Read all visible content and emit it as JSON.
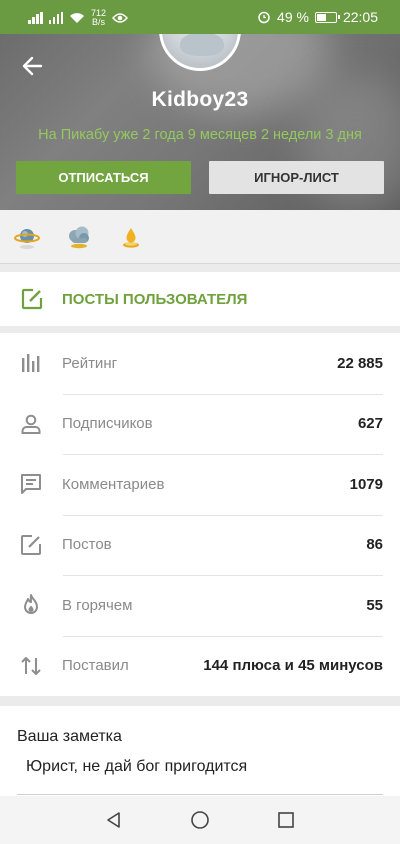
{
  "status_bar": {
    "net_speed_value": "712",
    "net_speed_unit": "B/s",
    "battery": "49 %",
    "time": "22:05"
  },
  "profile": {
    "username": "Kidboy23",
    "since": "На Пикабу уже 2 года 9 месяцев 2 недели 3 дня",
    "unsubscribe_label": "Отписаться",
    "ignore_label": "Игнор-лист"
  },
  "awards": [
    "planet-award-icon",
    "cloud-award-icon",
    "gold-drop-award-icon"
  ],
  "posts_link": {
    "label": "Посты пользователя"
  },
  "stats": [
    {
      "icon": "rating-bars-icon",
      "label": "Рейтинг",
      "value": "22 885"
    },
    {
      "icon": "person-icon",
      "label": "Подписчиков",
      "value": "627"
    },
    {
      "icon": "comment-icon",
      "label": "Комментариев",
      "value": "1079"
    },
    {
      "icon": "edit-icon",
      "label": "Постов",
      "value": "86"
    },
    {
      "icon": "flame-icon",
      "label": "В горячем",
      "value": "55"
    },
    {
      "icon": "up-down-arrows-icon",
      "label": "Поставил",
      "value": "144 плюса и 45 минусов"
    }
  ],
  "note": {
    "title": "Ваша заметка",
    "text": "Юрист, не дай бог пригодится"
  },
  "colors": {
    "accent_green": "#72a43f",
    "status_bar_green": "#6a9a41",
    "since_text_green": "#94c95c"
  }
}
